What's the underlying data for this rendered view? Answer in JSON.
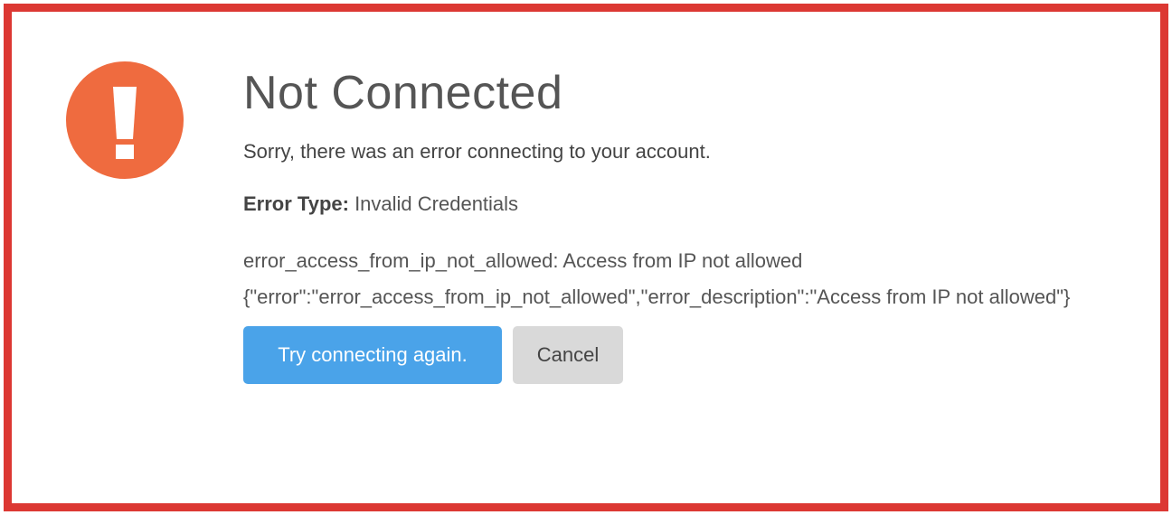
{
  "dialog": {
    "icon": "exclamation-circle-icon",
    "icon_color": "#ef6b3f",
    "border_color": "#dc3833",
    "title": "Not Connected",
    "subtitle": "Sorry, there was an error connecting to your account.",
    "error_type_label": "Error Type:",
    "error_type_value": " Invalid Credentials",
    "error_detail_line1": "error_access_from_ip_not_allowed: Access from IP not allowed",
    "error_detail_line2": "{\"error\":\"error_access_from_ip_not_allowed\",\"error_description\":\"Access from IP not allowed\"}",
    "retry_label": "Try connecting again.",
    "cancel_label": "Cancel",
    "primary_color": "#4aa3e9",
    "secondary_color": "#d9d9d9"
  }
}
